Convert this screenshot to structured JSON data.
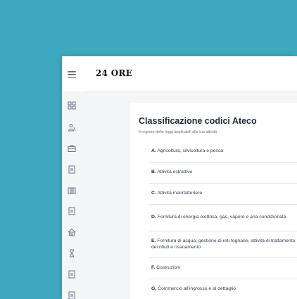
{
  "header": {
    "logo": "24 ORE",
    "menu_icon": "hamburger-menu-icon"
  },
  "sidebar": {
    "icons": [
      "grid-icon",
      "users-icon",
      "briefcase-icon",
      "document-icon",
      "book-icon",
      "document-icon",
      "home-icon",
      "hourglass-icon",
      "document-icon",
      "document-icon"
    ]
  },
  "page": {
    "title": "Classificazione codici Ateco",
    "subtitle": "Il registro delle leggi applicabili alla tua attività"
  },
  "sectors": [
    {
      "code": "A.",
      "label": "Agricoltura, silvicoltura e pesca"
    },
    {
      "code": "B.",
      "label": "Attività estrattive"
    },
    {
      "code": "C.",
      "label": "Attività manifatturiere"
    },
    {
      "code": "D.",
      "label": "Fornitura di energia elettrica, gas, vapore e aria condizionata"
    },
    {
      "code": "E.",
      "label": "Fornitura di acqua; gestione di reti fognarie, attività di trattamento dei rifiuti e risanamento"
    },
    {
      "code": "F.",
      "label": "Costruzioni"
    },
    {
      "code": "G.",
      "label": "Commercio all'ingrosso e al dettaglio"
    }
  ],
  "colors": {
    "background": "#3fa9c1",
    "window": "#f4f5f7",
    "card": "#ffffff",
    "text": "#1f2937"
  }
}
